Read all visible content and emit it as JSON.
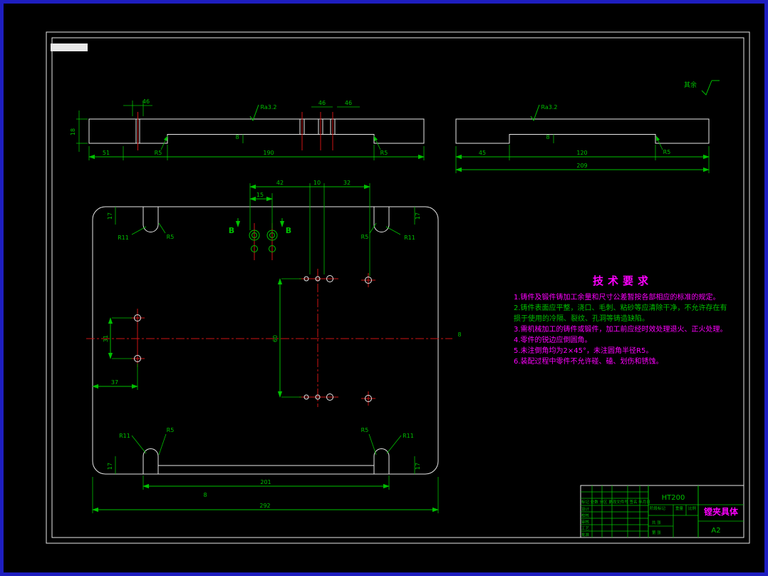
{
  "palette": {
    "background": "#000000",
    "outer_frame": "#1e1ec0",
    "outline_white": "#e8e8e8",
    "dimension_green": "#00c000",
    "centerline_red": "#cc1515",
    "note_magenta": "#ff00ff",
    "note_green": "#00c000"
  },
  "surface_note": {
    "text": "其余"
  },
  "sections": {
    "left": {
      "dim_top_a": "46",
      "dim_top_b": "46",
      "dim_top_c": "46",
      "ra": "Ra3.2",
      "thickness": "18",
      "depth": "8",
      "dim_51": "51",
      "dim_190": "190",
      "fillet": "R5"
    },
    "right": {
      "ra": "Ra3.2",
      "depth": "8",
      "dim_45": "45",
      "dim_120": "120",
      "fillet": "R5",
      "dim_total": "209"
    }
  },
  "plan": {
    "r11": "R11",
    "r5": "R5",
    "dim_17": "17",
    "dim_42": "42",
    "dim_10": "10",
    "dim_32": "32",
    "dim_15": "15",
    "dim_60": "60",
    "dim_31": "31",
    "dim_37": "37",
    "dim_201": "201",
    "dim_292": "292",
    "dim_8": "8",
    "section_mark": "B"
  },
  "tech_requirements": {
    "title": "技术要求",
    "items": [
      {
        "text": "1.铸件及锻件铸加工余量和尺寸公差暂按各部相应的标准的规定。",
        "color": "#ff00ff"
      },
      {
        "text": "2.铸件表面应平整，浇口、毛刺、粘砂等应清除干净，不允许存在有损于使用的冷隔、裂纹、孔洞等铸造缺陷。",
        "color": "#00c000"
      },
      {
        "text": "3.需机械加工的铸件或锻件，加工前应经时效处理退火、正火处理。",
        "color": "#ff00ff"
      },
      {
        "text": "4.零件的锐边应倒圆角。",
        "color": "#ff00ff"
      },
      {
        "text": "5.未注倒角均为2×45°，未注圆角半径R5。",
        "color": "#ff00ff"
      },
      {
        "text": "6.装配过程中零件不允许碰、磕、划伤和锈蚀。",
        "color": "#ff00ff"
      }
    ]
  },
  "title_block": {
    "material": "HT200",
    "part_name": "镗夹具体",
    "sheet_size": "A2",
    "labels": {
      "mark_row": "标记 处数 分区 更改文件号 签名 年月日",
      "design": "设计",
      "check": "校核",
      "review": "审核",
      "process": "工艺",
      "approve": "批准",
      "stage": "阶段标记",
      "weight": "重量",
      "scale": "比例",
      "total_sheets": "共 张",
      "sheet_no": "第 张"
    }
  }
}
